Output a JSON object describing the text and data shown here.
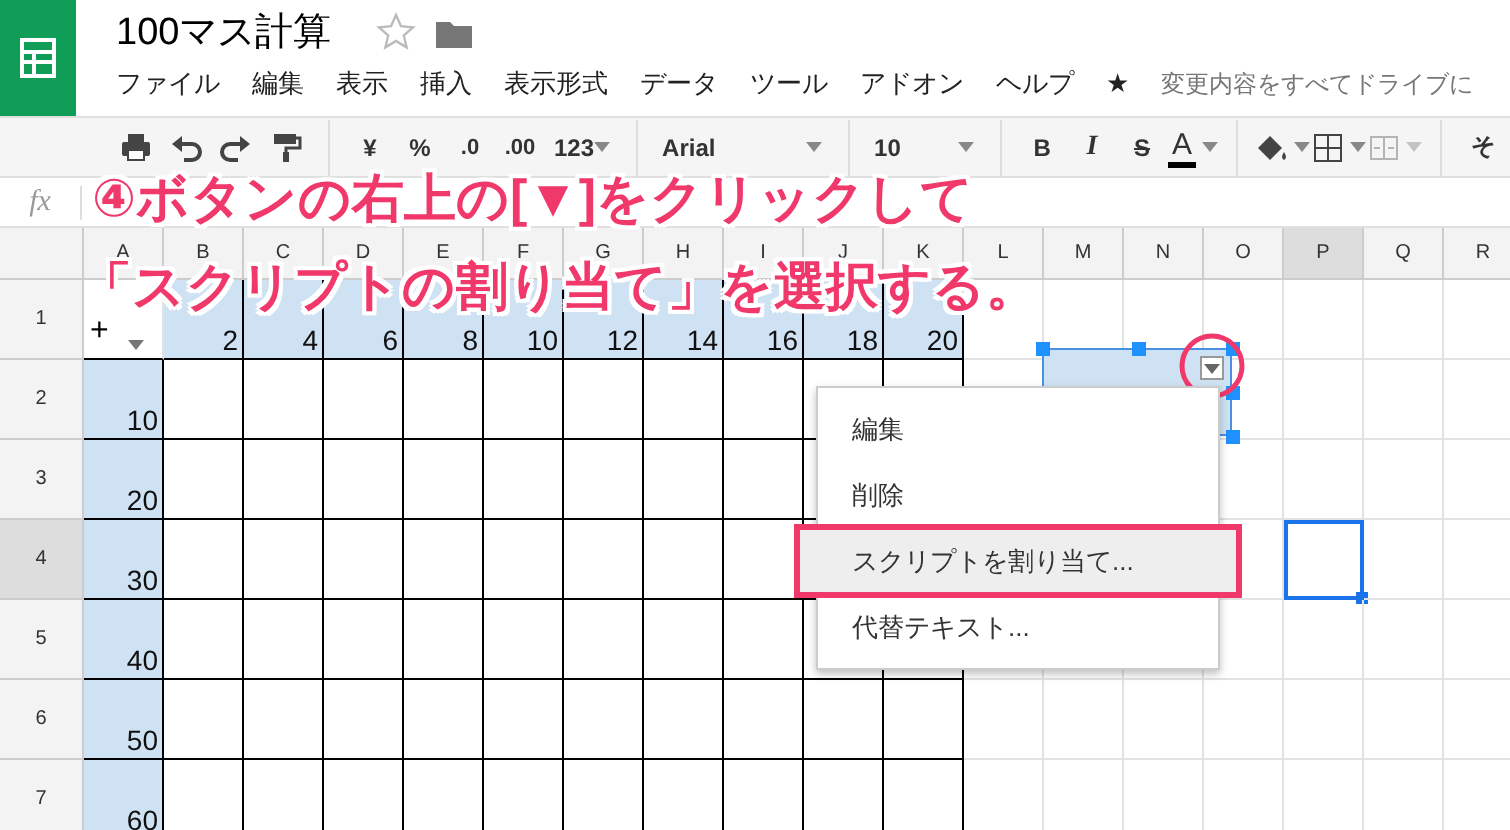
{
  "document": {
    "title": "100マス計算",
    "starred": false
  },
  "menu": [
    "ファイル",
    "編集",
    "表示",
    "挿入",
    "表示形式",
    "データ",
    "ツール",
    "アドオン",
    "ヘルプ",
    "★"
  ],
  "save_status": "変更内容をすべてドライブに",
  "toolbar": [
    {
      "kind": "print"
    },
    {
      "kind": "undo"
    },
    {
      "kind": "redo"
    },
    {
      "kind": "paint"
    },
    {
      "kind": "divider"
    },
    {
      "kind": "text",
      "label": "¥"
    },
    {
      "kind": "text",
      "label": "%"
    },
    {
      "kind": "decimal",
      "label": ".0"
    },
    {
      "kind": "decimal",
      "label": ".00"
    },
    {
      "kind": "dropdown",
      "label": "123"
    },
    {
      "kind": "divider"
    },
    {
      "kind": "dropdown",
      "label": "Arial"
    },
    {
      "kind": "divider"
    },
    {
      "kind": "dropdown",
      "label": "10"
    },
    {
      "kind": "divider"
    },
    {
      "kind": "bold",
      "label": "B"
    },
    {
      "kind": "italic",
      "label": "I"
    },
    {
      "kind": "strike",
      "label": "S"
    },
    {
      "kind": "color",
      "label": "A"
    },
    {
      "kind": "divider"
    },
    {
      "kind": "fill"
    },
    {
      "kind": "borders"
    },
    {
      "kind": "merge",
      "disabled": true
    },
    {
      "kind": "divider"
    },
    {
      "kind": "text",
      "label": "そ"
    }
  ],
  "formula_bar": {
    "label": "fx"
  },
  "columns": [
    {
      "label": "A",
      "selected": false
    },
    {
      "label": "B",
      "selected": false
    },
    {
      "label": "C",
      "selected": false
    },
    {
      "label": "D",
      "selected": false
    },
    {
      "label": "E",
      "selected": false
    },
    {
      "label": "F",
      "selected": false
    },
    {
      "label": "G",
      "selected": false
    },
    {
      "label": "H",
      "selected": false
    },
    {
      "label": "I",
      "selected": false
    },
    {
      "label": "J",
      "selected": false
    },
    {
      "label": "K",
      "selected": false
    },
    {
      "label": "L",
      "selected": false
    },
    {
      "label": "M",
      "selected": false
    },
    {
      "label": "N",
      "selected": false
    },
    {
      "label": "O",
      "selected": false
    },
    {
      "label": "P",
      "selected": true
    },
    {
      "label": "Q",
      "selected": false
    },
    {
      "label": "R",
      "selected": false
    }
  ],
  "rows": [
    {
      "label": "1",
      "selected": false,
      "cells": [
        {
          "kind": "corner",
          "text": "+"
        },
        {
          "kind": "head",
          "text": "2"
        },
        {
          "kind": "head",
          "text": "4"
        },
        {
          "kind": "head",
          "text": "6"
        },
        {
          "kind": "head",
          "text": "8"
        },
        {
          "kind": "head",
          "text": "10"
        },
        {
          "kind": "head",
          "text": "12"
        },
        {
          "kind": "head",
          "text": "14"
        },
        {
          "kind": "head",
          "text": "16"
        },
        {
          "kind": "head",
          "text": "18"
        },
        {
          "kind": "head",
          "text": "20"
        }
      ]
    },
    {
      "label": "2",
      "selected": false,
      "cells": [
        {
          "kind": "head",
          "text": "10"
        },
        {
          "kind": "box"
        },
        {
          "kind": "box"
        },
        {
          "kind": "box"
        },
        {
          "kind": "box"
        },
        {
          "kind": "box"
        },
        {
          "kind": "box"
        },
        {
          "kind": "box"
        },
        {
          "kind": "box"
        },
        {
          "kind": "box"
        },
        {
          "kind": "box"
        }
      ]
    },
    {
      "label": "3",
      "selected": false,
      "cells": [
        {
          "kind": "head",
          "text": "20"
        },
        {
          "kind": "box"
        },
        {
          "kind": "box"
        },
        {
          "kind": "box"
        },
        {
          "kind": "box"
        },
        {
          "kind": "box"
        },
        {
          "kind": "box"
        },
        {
          "kind": "box"
        },
        {
          "kind": "box"
        },
        {
          "kind": "box"
        },
        {
          "kind": "box"
        }
      ]
    },
    {
      "label": "4",
      "selected": true,
      "cells": [
        {
          "kind": "head",
          "text": "30"
        },
        {
          "kind": "box"
        },
        {
          "kind": "box"
        },
        {
          "kind": "box"
        },
        {
          "kind": "box"
        },
        {
          "kind": "box"
        },
        {
          "kind": "box"
        },
        {
          "kind": "box"
        },
        {
          "kind": "box"
        },
        {
          "kind": "box"
        },
        {
          "kind": "box"
        }
      ]
    },
    {
      "label": "5",
      "selected": false,
      "cells": [
        {
          "kind": "head",
          "text": "40"
        },
        {
          "kind": "box"
        },
        {
          "kind": "box"
        },
        {
          "kind": "box"
        },
        {
          "kind": "box"
        },
        {
          "kind": "box"
        },
        {
          "kind": "box"
        },
        {
          "kind": "box"
        },
        {
          "kind": "box"
        },
        {
          "kind": "box"
        },
        {
          "kind": "box"
        }
      ]
    },
    {
      "label": "6",
      "selected": false,
      "cells": [
        {
          "kind": "head",
          "text": "50"
        },
        {
          "kind": "box"
        },
        {
          "kind": "box"
        },
        {
          "kind": "box"
        },
        {
          "kind": "box"
        },
        {
          "kind": "box"
        },
        {
          "kind": "box"
        },
        {
          "kind": "box"
        },
        {
          "kind": "box"
        },
        {
          "kind": "box"
        },
        {
          "kind": "box"
        }
      ]
    },
    {
      "label": "7",
      "selected": false,
      "cells": [
        {
          "kind": "head",
          "text": "60"
        },
        {
          "kind": "box"
        },
        {
          "kind": "box"
        },
        {
          "kind": "box"
        },
        {
          "kind": "box"
        },
        {
          "kind": "box"
        },
        {
          "kind": "box"
        },
        {
          "kind": "box"
        },
        {
          "kind": "box"
        },
        {
          "kind": "box"
        },
        {
          "kind": "box"
        }
      ]
    }
  ],
  "drawing": {
    "selected": true,
    "annotated": true
  },
  "context_menu": [
    {
      "label": "編集",
      "selected": false,
      "annotated": false
    },
    {
      "label": "削除",
      "selected": false,
      "annotated": false
    },
    {
      "label": "スクリプトを割り当て...",
      "selected": true,
      "annotated": true
    },
    {
      "label": "代替テキスト...",
      "selected": false,
      "annotated": false
    }
  ],
  "annotation": [
    "④ボタンの右上の[▼]をクリックして",
    "「スクリプトの割り当て」を選択する。"
  ]
}
